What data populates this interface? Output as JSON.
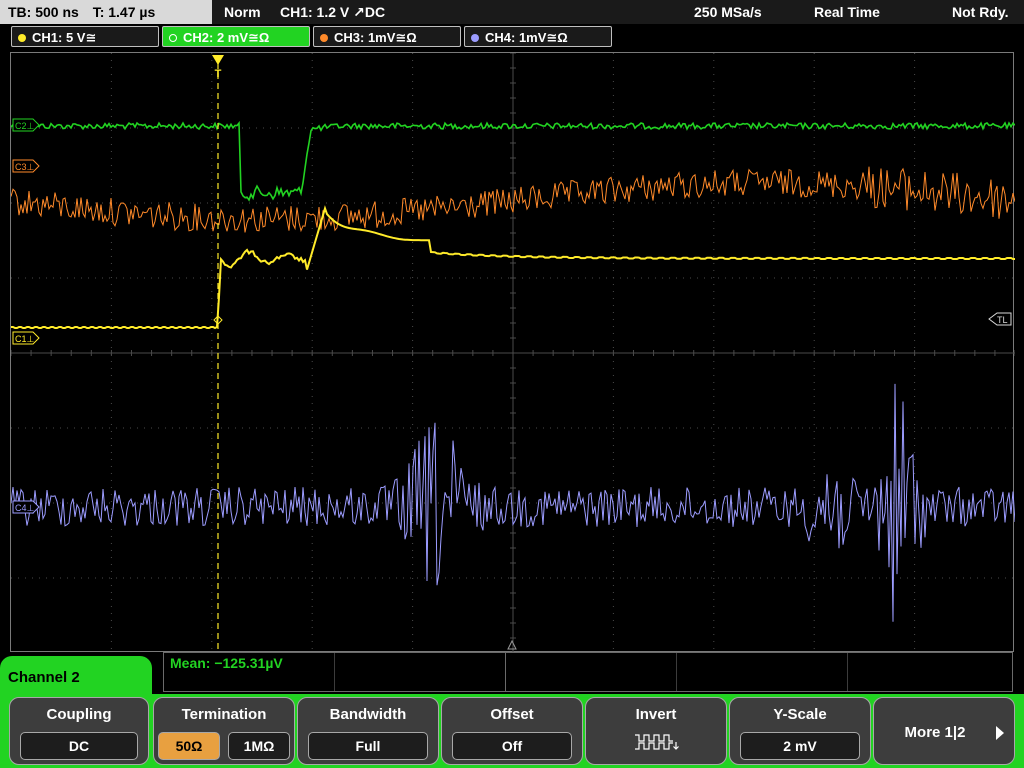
{
  "top": {
    "timebase": "TB: 500 ns",
    "trigger_time": "T: 1.47 µs",
    "mode": "Norm",
    "trigger": "CH1: 1.2 V ↗DC",
    "sample_rate": "250 MSa/s",
    "acquisition": "Real Time",
    "status": "Not Rdy."
  },
  "channels": [
    {
      "label": "CH1: 5 V≅",
      "color": "#ffeb2a"
    },
    {
      "label": "CH2: 2 mV≅Ω",
      "color": "#22d322"
    },
    {
      "label": "CH3: 1mV≅Ω",
      "color": "#ff8a2a"
    },
    {
      "label": "CH4: 1mV≅Ω",
      "color": "#9c9cff"
    }
  ],
  "markers": {
    "c1": "C1⊥",
    "c2": "C2⊥",
    "c3": "C3⊥",
    "c4": "C4⊥",
    "tl": "TL",
    "trig": "T"
  },
  "measurement": {
    "label": "Mean: −125.31µV"
  },
  "menu": {
    "channel": "Channel 2",
    "coupling": {
      "title": "Coupling",
      "value": "DC"
    },
    "termination": {
      "title": "Termination",
      "opt1": "50Ω",
      "opt2": "1MΩ"
    },
    "bandwidth": {
      "title": "Bandwidth",
      "value": "Full"
    },
    "offset": {
      "title": "Offset",
      "value": "Off"
    },
    "invert": {
      "title": "Invert"
    },
    "yscale": {
      "title": "Y-Scale",
      "value": "2 mV"
    },
    "more": {
      "label": "More 1|2"
    }
  },
  "colors": {
    "ch1": "#ffeb2a",
    "ch2": "#22d322",
    "ch3": "#ff8a2a",
    "ch4": "#9c9cff",
    "grid": "#4a4a4a"
  }
}
